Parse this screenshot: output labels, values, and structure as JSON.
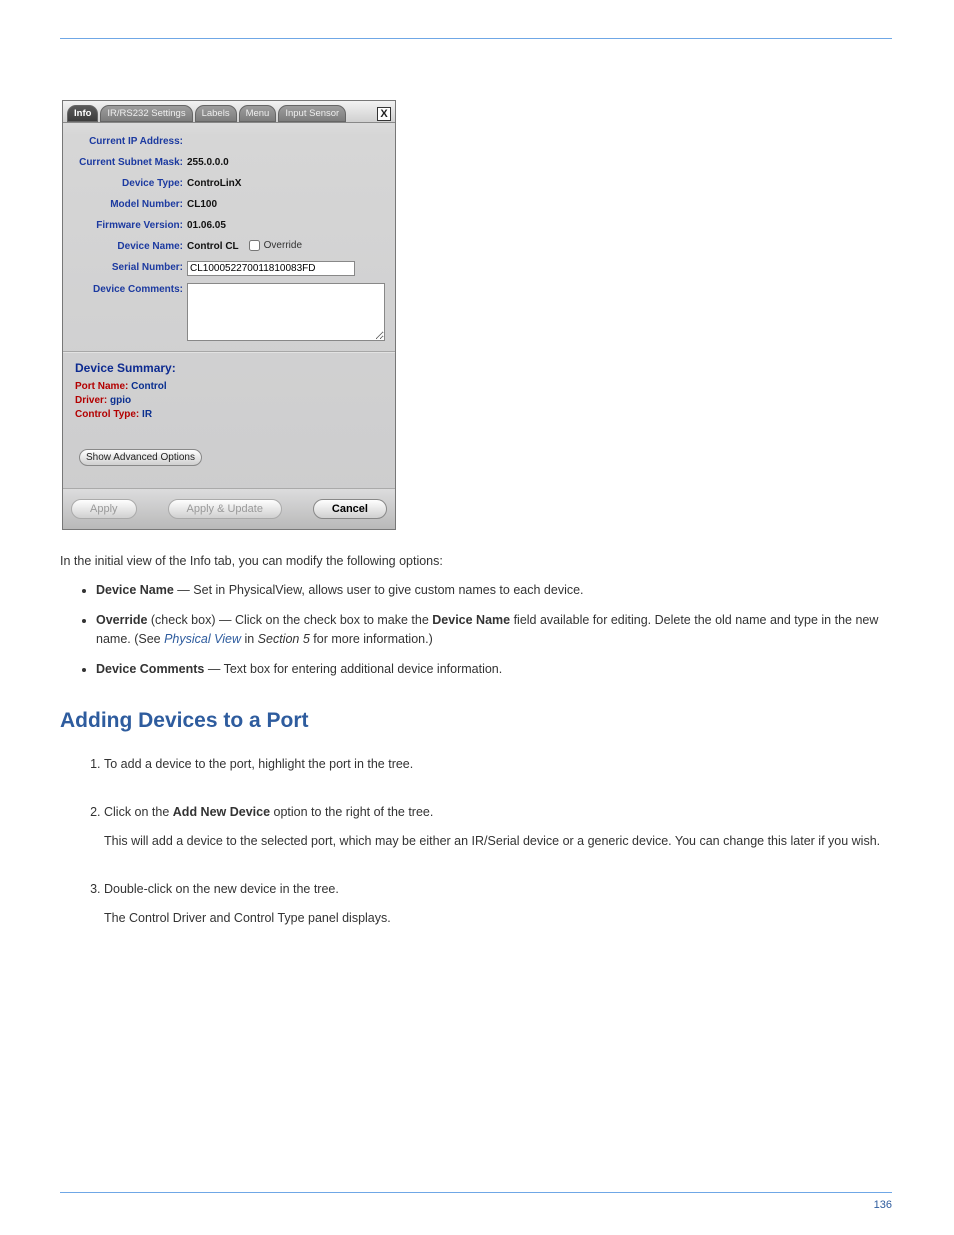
{
  "dialog": {
    "tabs": [
      "Info",
      "IR/RS232 Settings",
      "Labels",
      "Menu",
      "Input Sensor"
    ],
    "active_tab": "Info",
    "close": "X",
    "fields": {
      "ip_label": "Current IP Address:",
      "ip_value": "",
      "subnet_label": "Current Subnet Mask:",
      "subnet_value": "255.0.0.0",
      "devtype_label": "Device Type:",
      "devtype_value": "ControLinX",
      "model_label": "Model Number:",
      "model_value": "CL100",
      "fw_label": "Firmware Version:",
      "fw_value": "01.06.05",
      "devname_label": "Device Name:",
      "devname_value": "Control CL",
      "override_label": "Override",
      "serial_label": "Serial Number:",
      "serial_value": "CL100052270011810083FD",
      "comments_label": "Device Comments:",
      "comments_value": ""
    },
    "summary": {
      "heading": "Device Summary:",
      "portname_k": "Port Name:",
      "portname_v": "Control",
      "driver_k": "Driver:",
      "driver_v": "gpio",
      "ctrltype_k": "Control Type:",
      "ctrltype_v": "IR"
    },
    "adv_btn": "Show Advanced Options",
    "buttons": {
      "apply": "Apply",
      "applyupdate": "Apply & Update",
      "cancel": "Cancel"
    }
  },
  "doc": {
    "intro": "In the initial view of the Info tab, you can modify the following options:",
    "bullets": {
      "b1a": "Device Name",
      "b1b": " — Set in PhysicalView, allows user to give custom names to each device.",
      "b2a": "Override ",
      "b2b": "(check box) — Click on the check box to make the ",
      "b2c": "Device Name",
      "b2d": " field available for editing. Delete the old name and type in the new name. (See ",
      "b2e": "Physical View",
      "b2f": " in ",
      "b2g": "Section 5",
      "b2h": " for more information.)",
      "b3a": "Device Comments",
      "b3b": " — Text box for entering additional device information."
    },
    "heading": "Adding Devices to a Port",
    "steps": {
      "s1": "To add a device to the port, highlight the port in the tree.",
      "s2a": "Click on the ",
      "s2b": "Add New Device",
      "s2c": " option to the right of the tree.",
      "s2_inner": "This will add a device to the selected port, which may be either an IR/Serial device or a generic device. You can change this later if you wish.",
      "s3": "Double-click on the new device in the tree.",
      "s3_inner": "The Control Driver and Control Type panel displays."
    },
    "footer": "136"
  }
}
